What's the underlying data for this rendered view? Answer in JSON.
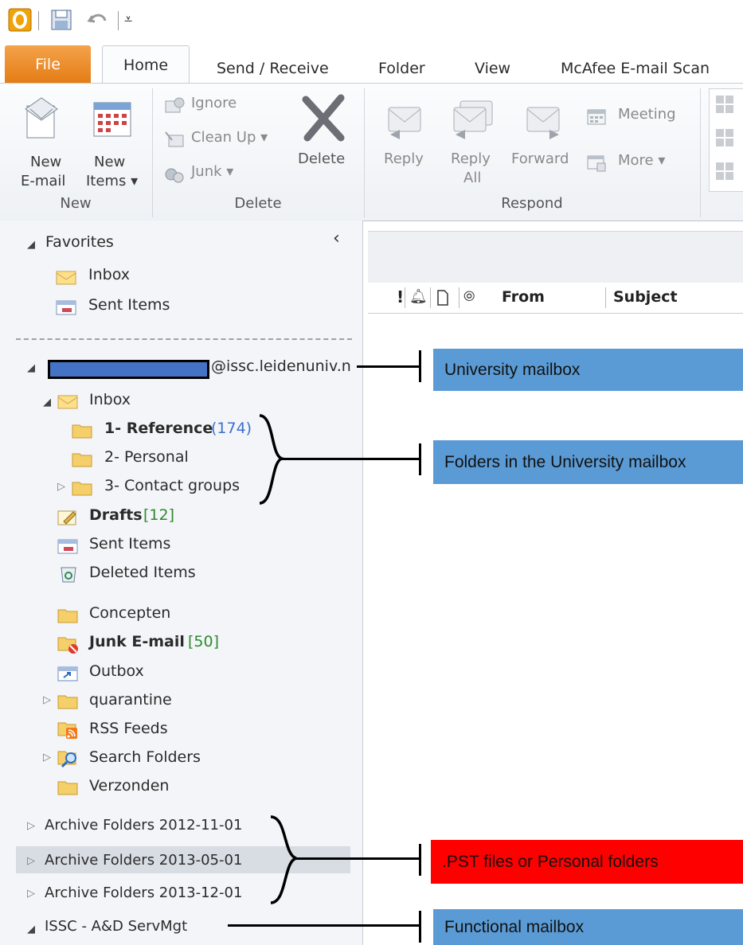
{
  "qat": {
    "icons": [
      "outlook-icon",
      "save-icon",
      "undo-icon",
      "customize-icon"
    ]
  },
  "tabs": {
    "file": "File",
    "home": "Home",
    "send_receive": "Send / Receive",
    "folder": "Folder",
    "view": "View",
    "mcafee": "McAfee E-mail Scan"
  },
  "ribbon": {
    "new_email_1": "New",
    "new_email_2": "E-mail",
    "new_items_1": "New",
    "new_items_2": "Items ▾",
    "new_group": "New",
    "ignore": "Ignore",
    "cleanup": "Clean Up ▾",
    "junk": "Junk ▾",
    "delete": "Delete",
    "delete_group": "Delete",
    "reply": "Reply",
    "reply_all_1": "Reply",
    "reply_all_2": "All",
    "forward": "Forward",
    "meeting": "Meeting",
    "more": "More ▾",
    "respond_group": "Respond"
  },
  "nav": {
    "favorites": "Favorites",
    "fav_inbox": "Inbox",
    "fav_sent": "Sent Items",
    "account_suffix": "@issc.leidenuniv.n",
    "inbox": "Inbox",
    "ref": "1- Reference",
    "ref_count": "(174)",
    "personal": "2- Personal",
    "contact": "3- Contact groups",
    "drafts": "Drafts",
    "drafts_count": "[12]",
    "sent": "Sent Items",
    "deleted": "Deleted Items",
    "concepten": "Concepten",
    "junk": "Junk E-mail",
    "junk_count": "[50]",
    "outbox": "Outbox",
    "quarantine": "quarantine",
    "rss": "RSS Feeds",
    "search": "Search Folders",
    "verzonden": "Verzonden",
    "arch1": "Archive Folders 2012-11-01",
    "arch2": "Archive Folders 2013-05-01",
    "arch3": "Archive Folders 2013-12-01",
    "issc": "ISSC - A&D ServMgt"
  },
  "columns": {
    "from": "From",
    "subject": "Subject"
  },
  "callouts": {
    "university": "University mailbox",
    "folders": "Folders in the University mailbox",
    "pst": ".PST files or Personal folders",
    "functional": "Functional mailbox"
  },
  "colors": {
    "callout_blue": "#5b9bd5",
    "callout_red": "#ff0000",
    "file_tab": "#e47c14",
    "count_blue": "#3b6fd1",
    "count_green": "#2f8a2f"
  }
}
